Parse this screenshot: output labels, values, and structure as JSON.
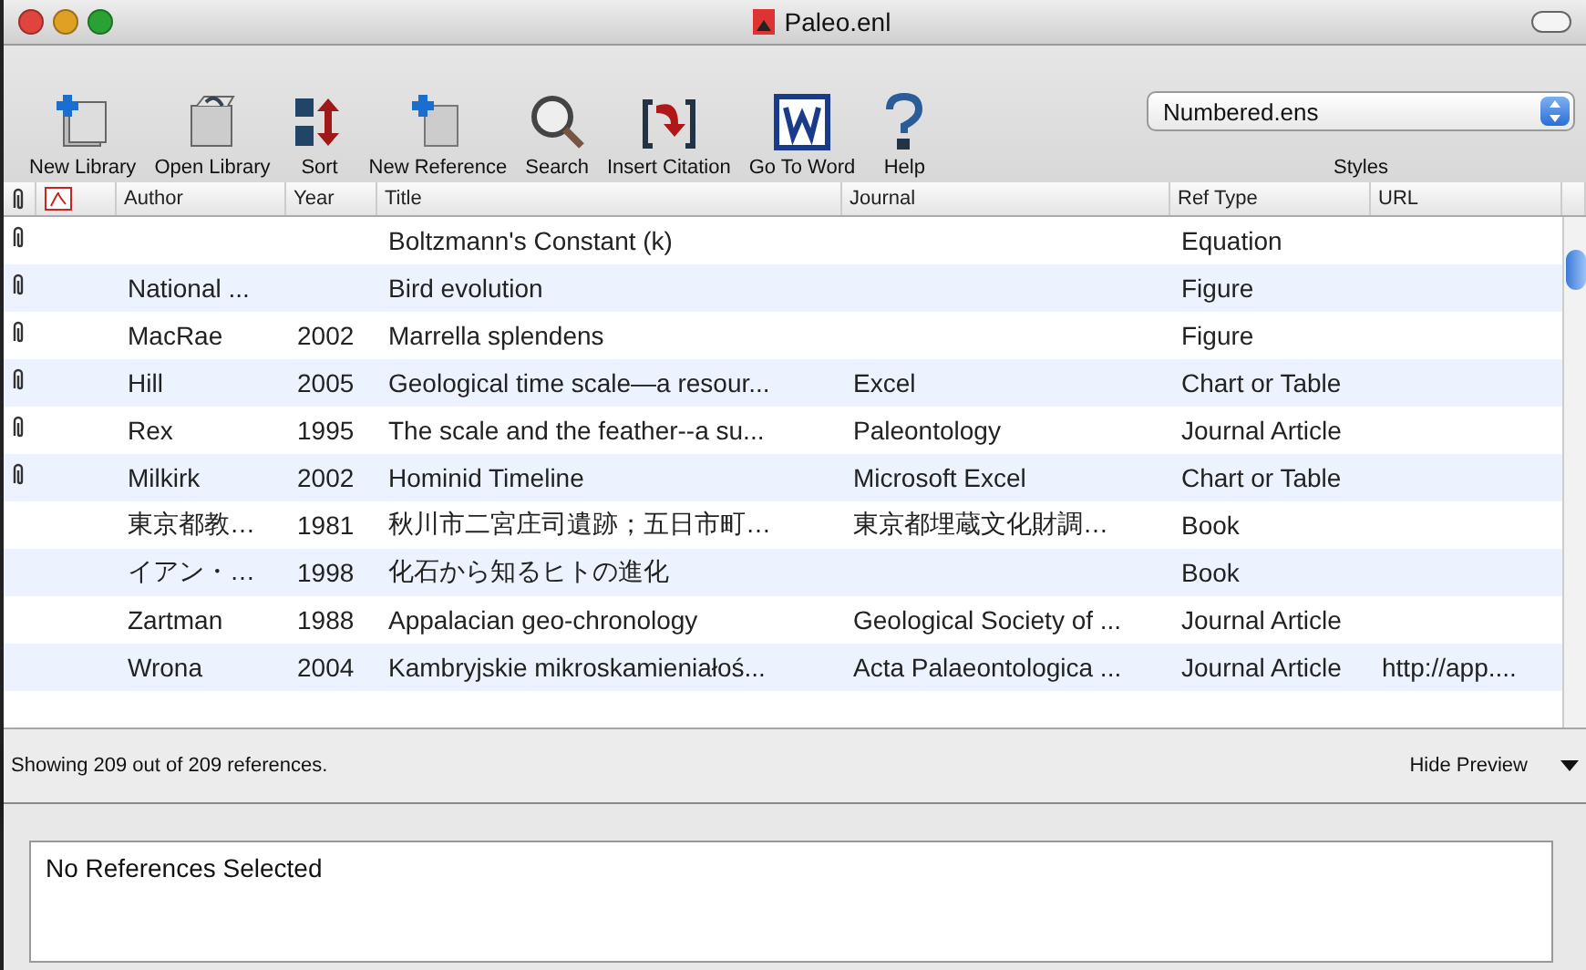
{
  "window": {
    "title": "Paleo.enl"
  },
  "toolbar": [
    {
      "label": "New Library",
      "kind": "new-library"
    },
    {
      "label": "Open Library",
      "kind": "open-library"
    },
    {
      "label": "Sort",
      "kind": "sort"
    },
    {
      "label": "New Reference",
      "kind": "new-reference"
    },
    {
      "label": "Search",
      "kind": "search"
    },
    {
      "label": "Insert Citation",
      "kind": "insert-citation"
    },
    {
      "label": "Go To Word",
      "kind": "go-to-word"
    },
    {
      "label": "Help",
      "kind": "help"
    }
  ],
  "styles": {
    "value": "Numbered.ens",
    "label": "Styles"
  },
  "table": {
    "columns": [
      "Author",
      "Year",
      "Title",
      "Journal",
      "Ref Type",
      "URL"
    ],
    "rows": [
      {
        "attachment": true,
        "cells": [
          "",
          "",
          "Boltzmann's Constant (k)",
          "",
          "Equation",
          ""
        ]
      },
      {
        "attachment": true,
        "cells": [
          "National ...",
          "",
          "Bird evolution",
          "",
          "Figure",
          ""
        ]
      },
      {
        "attachment": true,
        "cells": [
          "MacRae",
          "2002",
          "Marrella splendens",
          "",
          "Figure",
          ""
        ]
      },
      {
        "attachment": true,
        "cells": [
          "Hill",
          "2005",
          "Geological time scale—a resour...",
          "Excel",
          "Chart or Table",
          ""
        ]
      },
      {
        "attachment": true,
        "cells": [
          "Rex",
          "1995",
          "The scale and the feather--a su...",
          "Paleontology",
          "Journal Article",
          ""
        ]
      },
      {
        "attachment": true,
        "cells": [
          "Milkirk",
          "2002",
          "Hominid Timeline",
          "Microsoft Excel",
          "Chart or Table",
          ""
        ]
      },
      {
        "attachment": false,
        "cells": [
          "東京都教…",
          "1981",
          "秋川市二宮庄司遺跡；五日市町…",
          "東京都埋蔵文化財調…",
          "Book",
          ""
        ]
      },
      {
        "attachment": false,
        "cells": [
          "イアン・…",
          "1998",
          "化石から知るヒトの進化",
          "",
          "Book",
          ""
        ]
      },
      {
        "attachment": false,
        "cells": [
          "Zartman",
          "1988",
          "Appalacian geo-chronology",
          "Geological Society of ...",
          "Journal Article",
          ""
        ]
      },
      {
        "attachment": false,
        "cells": [
          "Wrona",
          "2004",
          "Kambryjskie mikroskamieniałoś...",
          "Acta Palaeontologica ...",
          "Journal Article",
          "http://app...."
        ]
      }
    ]
  },
  "status_bar": {
    "text": "Showing 209 out of 209 references.",
    "toggle": "Hide Preview"
  },
  "preview": {
    "text": "No References Selected"
  }
}
